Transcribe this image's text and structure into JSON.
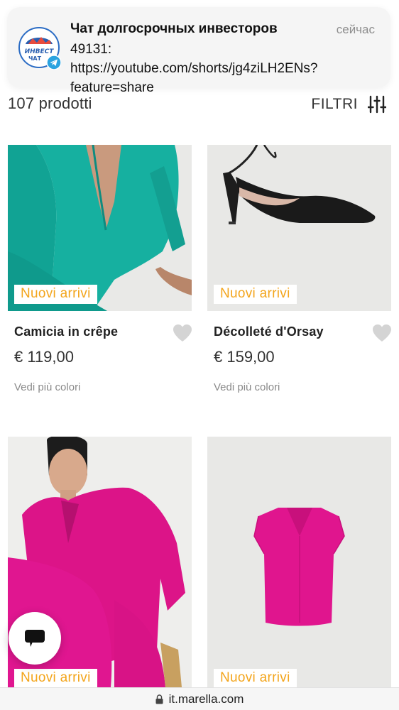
{
  "notification": {
    "title": "Чат долгосрочных инвесторов",
    "time": "сейчас",
    "body": "49131: https://youtube.com/shorts/jg4ziLH2ENs?feature=share",
    "avatar_text_top": "ИНВЕСТ",
    "avatar_text_bottom": "ЧАТ",
    "avatar_icon": "telegram-icon"
  },
  "listing": {
    "count_label": "107 prodotti",
    "filter_label": "FILTRI",
    "filter_icon": "sliders-icon"
  },
  "products": [
    {
      "badge": "Nuovi arrivi",
      "name": "Camicia in crêpe",
      "price": "€ 119,00",
      "colors": "Vedi più colori",
      "color": "#14a89a"
    },
    {
      "badge": "Nuovi arrivi",
      "name": "Décolleté d'Orsay",
      "price": "€ 159,00",
      "colors": "Vedi più colori",
      "color": "#1a1a1a"
    },
    {
      "badge": "Nuovi arrivi",
      "color": "#e0158e"
    },
    {
      "badge": "Nuovi arrivi",
      "color": "#e0158e"
    }
  ],
  "colors": {
    "badge_text": "#f3a51c",
    "heart": "#d4d4d4",
    "image_bg": "#e8e8e6"
  },
  "chat": {
    "icon": "chat-bubble-icon"
  },
  "browser": {
    "url": "it.marella.com",
    "lock_icon": "lock-icon"
  }
}
